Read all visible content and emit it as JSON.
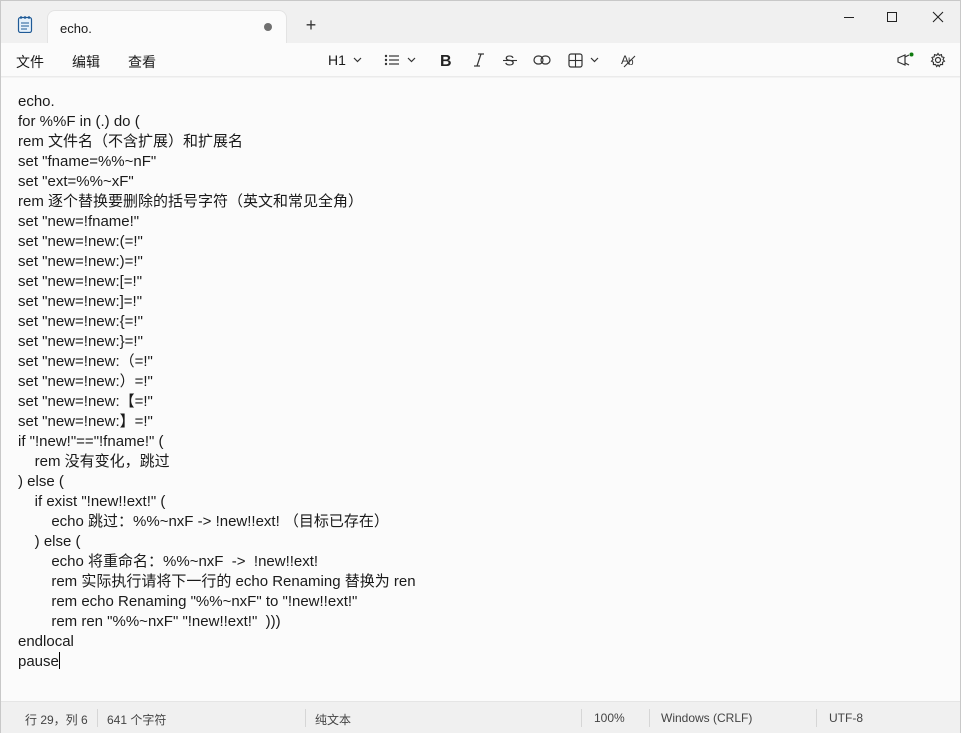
{
  "app": {
    "tab_title": "echo.",
    "new_tab_symbol": "+"
  },
  "menu": {
    "file": "文件",
    "edit": "编辑",
    "view": "查看"
  },
  "toolbar": {
    "heading": "H1"
  },
  "editor": {
    "lines": [
      "echo.",
      "for %%F in (.) do (",
      "rem 文件名（不含扩展）和扩展名",
      "set \"fname=%%~nF\"",
      "set \"ext=%%~xF\"",
      "rem 逐个替换要删除的括号字符（英文和常见全角）",
      "set \"new=!fname!\"",
      "set \"new=!new:(=!\"",
      "set \"new=!new:)=!\"",
      "set \"new=!new:[=!\"",
      "set \"new=!new:]=!\"",
      "set \"new=!new:{=!\"",
      "set \"new=!new:}=!\"",
      "set \"new=!new:（=!\"",
      "set \"new=!new:）=!\"",
      "set \"new=!new:【=!\"",
      "set \"new=!new:】=!\"",
      "if \"!new!\"==\"!fname!\" (",
      "    rem 没有变化，跳过",
      ") else (",
      "    if exist \"!new!!ext!\" (",
      "        echo 跳过：%%~nxF -> !new!!ext! （目标已存在）",
      "    ) else (",
      "        echo 将重命名：%%~nxF  ->  !new!!ext!",
      "        rem 实际执行请将下一行的 echo Renaming 替换为 ren",
      "        rem echo Renaming \"%%~nxF\" to \"!new!!ext!\"",
      "        rem ren \"%%~nxF\" \"!new!!ext!\"  )))",
      "endlocal",
      "pause"
    ]
  },
  "status": {
    "position": "行 29，列 6",
    "char_count": "641 个字符",
    "format": "纯文本",
    "zoom": "100%",
    "line_ending": "Windows (CRLF)",
    "encoding": "UTF-8"
  },
  "colors": {
    "background": "#f3f3f3",
    "editor_bg": "#fbfbfb",
    "notification_dot": "#0f7b0f"
  }
}
